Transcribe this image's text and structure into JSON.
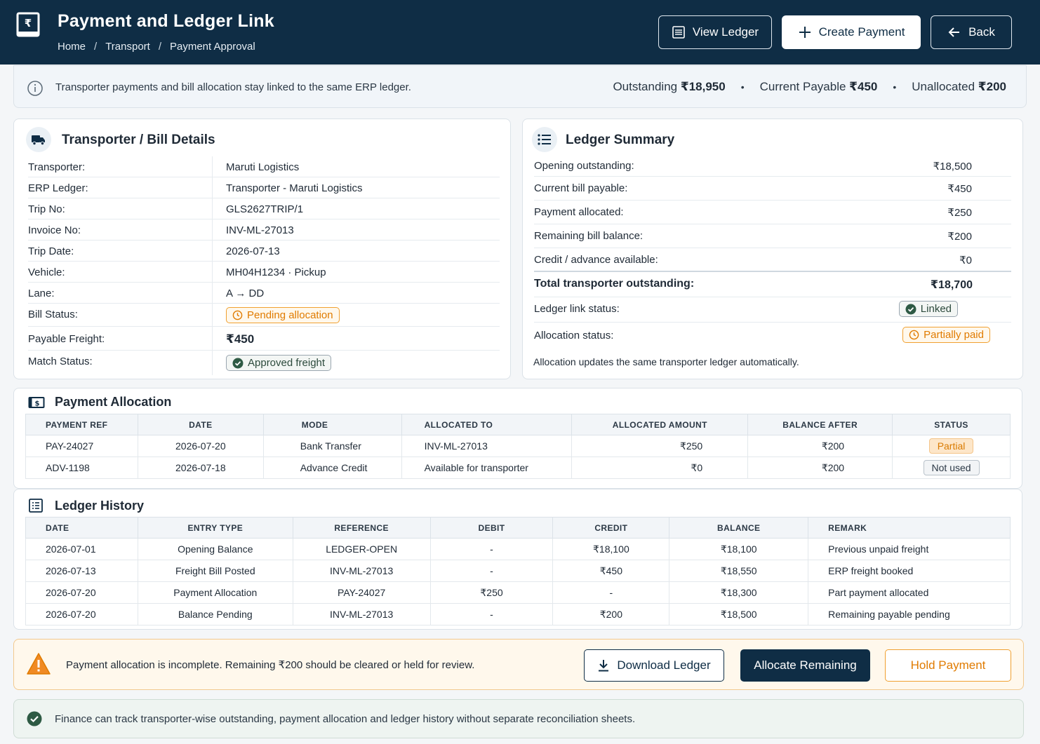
{
  "header": {
    "title": "Payment and Ledger Link",
    "breadcrumbs": [
      "Home",
      "Transport",
      "Payment Approval"
    ],
    "view_ledger": "View Ledger",
    "create_payment": "Create Payment",
    "back": "Back"
  },
  "info": {
    "text": "Transporter payments and bill allocation stay linked to the same ERP ledger.",
    "outstanding_label": "Outstanding",
    "outstanding_value": "₹18,950",
    "payable_label": "Current Payable",
    "payable_value": "₹450",
    "unallocated_label": "Unallocated",
    "unallocated_value": "₹200"
  },
  "details": {
    "title": "Transporter / Bill Details",
    "rows": [
      {
        "k": "Transporter:",
        "v": "Maruti Logistics"
      },
      {
        "k": "ERP Ledger:",
        "v": "Transporter - Maruti Logistics"
      },
      {
        "k": "Trip No:",
        "v": "GLS2627TRIP/1"
      },
      {
        "k": "Invoice No:",
        "v": "INV-ML-27013"
      },
      {
        "k": "Trip Date:",
        "v": "2026-07-13"
      },
      {
        "k": "Vehicle:",
        "v": "MH04H1234 · Pickup"
      },
      {
        "k": "Lane:",
        "v_from": "A",
        "v_to": "DD"
      },
      {
        "k": "Bill Status:",
        "v": "Pending allocation"
      },
      {
        "k": "Payable Freight:",
        "v": "₹450"
      },
      {
        "k": "Match Status:",
        "v": "Approved freight"
      }
    ]
  },
  "summary": {
    "title": "Ledger Summary",
    "rows": [
      {
        "k": "Opening outstanding:",
        "v": "₹18,500"
      },
      {
        "k": "Current bill payable:",
        "v": "₹450"
      },
      {
        "k": "Payment allocated:",
        "v": "₹250"
      },
      {
        "k": "Remaining bill balance:",
        "v": "₹200"
      },
      {
        "k": "Credit / advance available:",
        "v": "₹0"
      },
      {
        "k": "Total transporter outstanding:",
        "v": "₹18,700"
      },
      {
        "k": "Ledger link status:",
        "v": "Linked"
      },
      {
        "k": "Allocation status:",
        "v": "Partially paid"
      }
    ],
    "note": "Allocation updates the same transporter ledger automatically."
  },
  "allocation": {
    "title": "Payment Allocation",
    "columns": [
      "PAYMENT REF",
      "DATE",
      "MODE",
      "ALLOCATED TO",
      "ALLOCATED AMOUNT",
      "BALANCE AFTER",
      "STATUS"
    ],
    "rows": [
      [
        "PAY-24027",
        "2026-07-20",
        "Bank Transfer",
        "INV-ML-27013",
        "₹250",
        "₹200",
        "Partial"
      ],
      [
        "ADV-1198",
        "2026-07-18",
        "Advance Credit",
        "Available for transporter",
        "₹0",
        "₹200",
        "Not used"
      ]
    ]
  },
  "history": {
    "title": "Ledger History",
    "columns": [
      "DATE",
      "ENTRY TYPE",
      "REFERENCE",
      "DEBIT",
      "CREDIT",
      "BALANCE",
      "REMARK"
    ],
    "rows": [
      [
        "2026-07-01",
        "Opening Balance",
        "LEDGER-OPEN",
        "-",
        "₹18,100",
        "₹18,100",
        "Previous unpaid freight"
      ],
      [
        "2026-07-13",
        "Freight Bill Posted",
        "INV-ML-27013",
        "-",
        "₹450",
        "₹18,550",
        "ERP freight booked"
      ],
      [
        "2026-07-20",
        "Payment Allocation",
        "PAY-24027",
        "₹250",
        "-",
        "₹18,300",
        "Part payment allocated"
      ],
      [
        "2026-07-20",
        "Balance Pending",
        "INV-ML-27013",
        "-",
        "₹200",
        "₹18,500",
        "Remaining payable pending"
      ]
    ]
  },
  "warning": {
    "text": "Payment allocation is incomplete. Remaining ₹200 should be cleared or held for review.",
    "download": "Download Ledger",
    "allocate": "Allocate Remaining",
    "hold": "Hold Payment"
  },
  "footer": {
    "text": "Finance can track transporter-wise outstanding, payment allocation and ledger history without separate reconciliation sheets."
  },
  "colors": {
    "header_bg": "#0f2d45",
    "accent_orange": "#e07b00",
    "success_green": "#2e7d4f"
  }
}
